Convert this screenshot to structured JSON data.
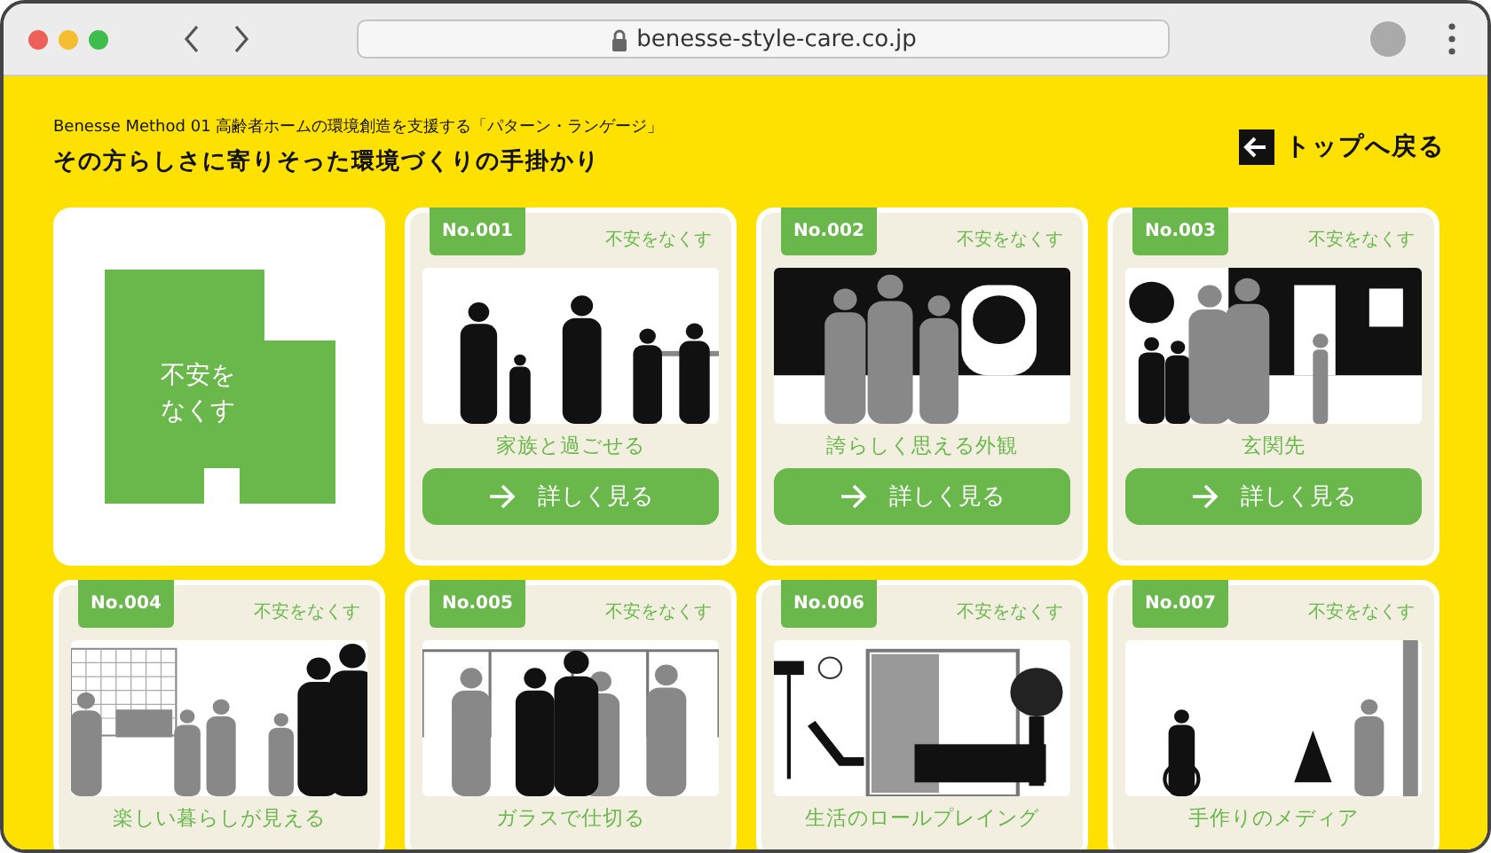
{
  "browser": {
    "url": "benesse-style-care.co.jp"
  },
  "header": {
    "subtitle": "Benesse Method 01 高齢者ホームの環境創造を支援する「パターン・ランゲージ」",
    "title": "その方らしさに寄りそった環境づくりの手掛かり",
    "back_link": "トップへ戻る"
  },
  "tiles": [
    {
      "kind": "category",
      "label": "不安をなくす"
    },
    {
      "kind": "pattern",
      "number": "No.001",
      "category": "不安をなくす",
      "title": "家族と過ごせる",
      "button": "詳しく見る"
    },
    {
      "kind": "pattern",
      "number": "No.002",
      "category": "不安をなくす",
      "title": "誇らしく思える外観",
      "button": "詳しく見る"
    },
    {
      "kind": "pattern",
      "number": "No.003",
      "category": "不安をなくす",
      "title": "玄関先",
      "button": "詳しく見る"
    },
    {
      "kind": "pattern",
      "number": "No.004",
      "category": "不安をなくす",
      "title": "楽しい暮らしが見える"
    },
    {
      "kind": "pattern",
      "number": "No.005",
      "category": "不安をなくす",
      "title": "ガラスで仕切る"
    },
    {
      "kind": "pattern",
      "number": "No.006",
      "category": "不安をなくす",
      "title": "生活のロールプレイング"
    },
    {
      "kind": "pattern",
      "number": "No.007",
      "category": "不安をなくす",
      "title": "手作りのメディア"
    }
  ]
}
